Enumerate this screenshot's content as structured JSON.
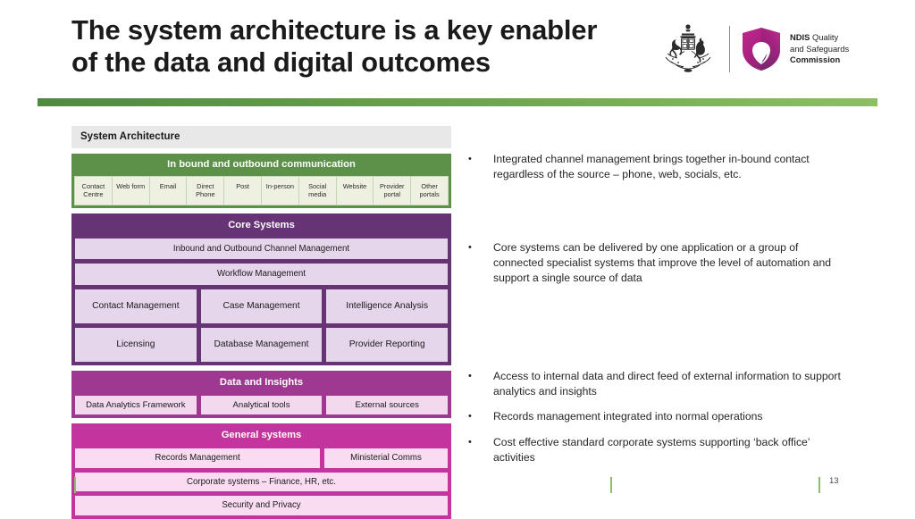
{
  "slide": {
    "title_line_1": "The system architecture is a key enabler",
    "title_line_2": "of the data and digital outcomes",
    "page_number": "13"
  },
  "logo": {
    "coat_of_arms_label": "australian-coat-of-arms",
    "shield_label": "ndis-shield",
    "wordmark_line_1_bold": "NDIS",
    "wordmark_line_1_rest": " Quality",
    "wordmark_line_2": "and Safeguards",
    "wordmark_line_3": "Commission"
  },
  "diagram": {
    "title": "System Architecture",
    "communication": {
      "heading": "In bound and outbound communication",
      "channels": [
        "Contact Centre",
        "Web form",
        "Email",
        "Direct Phone",
        "Post",
        "In-person",
        "Social media",
        "Website",
        "Provider portal",
        "Other portals"
      ]
    },
    "core_systems": {
      "heading": "Core Systems",
      "full_width_rows": [
        "Inbound and Outbound Channel Management",
        "Workflow Management"
      ],
      "grid_row_1": [
        "Contact Management",
        "Case Management",
        "Intelligence Analysis"
      ],
      "grid_row_2": [
        "Licensing",
        "Database Management",
        "Provider Reporting"
      ]
    },
    "data_and_insights": {
      "heading": "Data and Insights",
      "items": [
        "Data Analytics Framework",
        "Analytical tools",
        "External sources"
      ]
    },
    "general_systems": {
      "heading": "General systems",
      "row_1": [
        "Records Management",
        "Ministerial Comms"
      ],
      "row_2": "Corporate systems – Finance, HR, etc.",
      "row_3": "Security and Privacy"
    }
  },
  "bullets": [
    "Integrated channel management brings together in-bound contact regardless of the source – phone, web, socials, etc.",
    "Core systems can be delivered by one application or a group of connected specialist systems that improve the level of automation and support a single source of data",
    "Access to internal data and direct feed of external information to support analytics and insights",
    "Records management integrated into normal operations",
    "Cost effective standard corporate systems supporting ‘back office’ activities"
  ],
  "bullet_marker": "•",
  "colors": {
    "green_band": "#5d9149",
    "green_rule_start": "#4f8a3e",
    "green_rule_end": "#8cbf63",
    "core_purple": "#663374",
    "data_magenta": "#9e3890",
    "general_magenta": "#c4349e",
    "diagram_title_bg": "#e8e8e8"
  }
}
